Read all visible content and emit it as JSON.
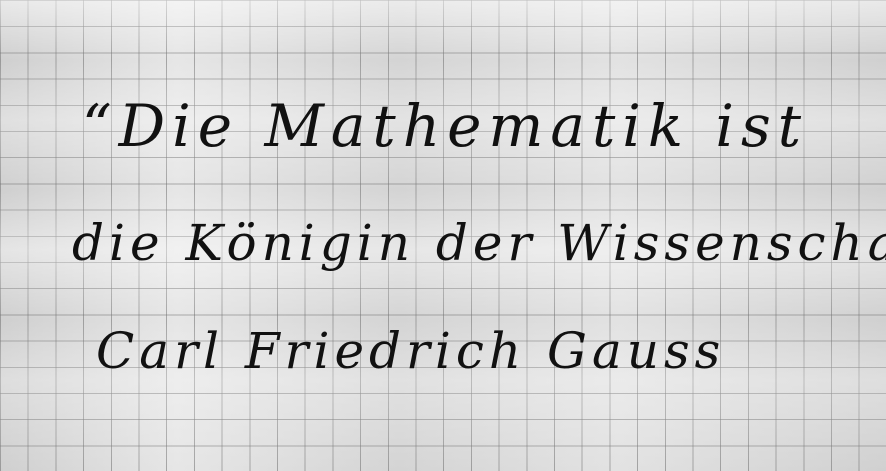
{
  "quote": {
    "line1": "“Die Mathematik ist",
    "line2": "die Königin der Wissenschaften”",
    "author": "Carl Friedrich Gauss"
  }
}
